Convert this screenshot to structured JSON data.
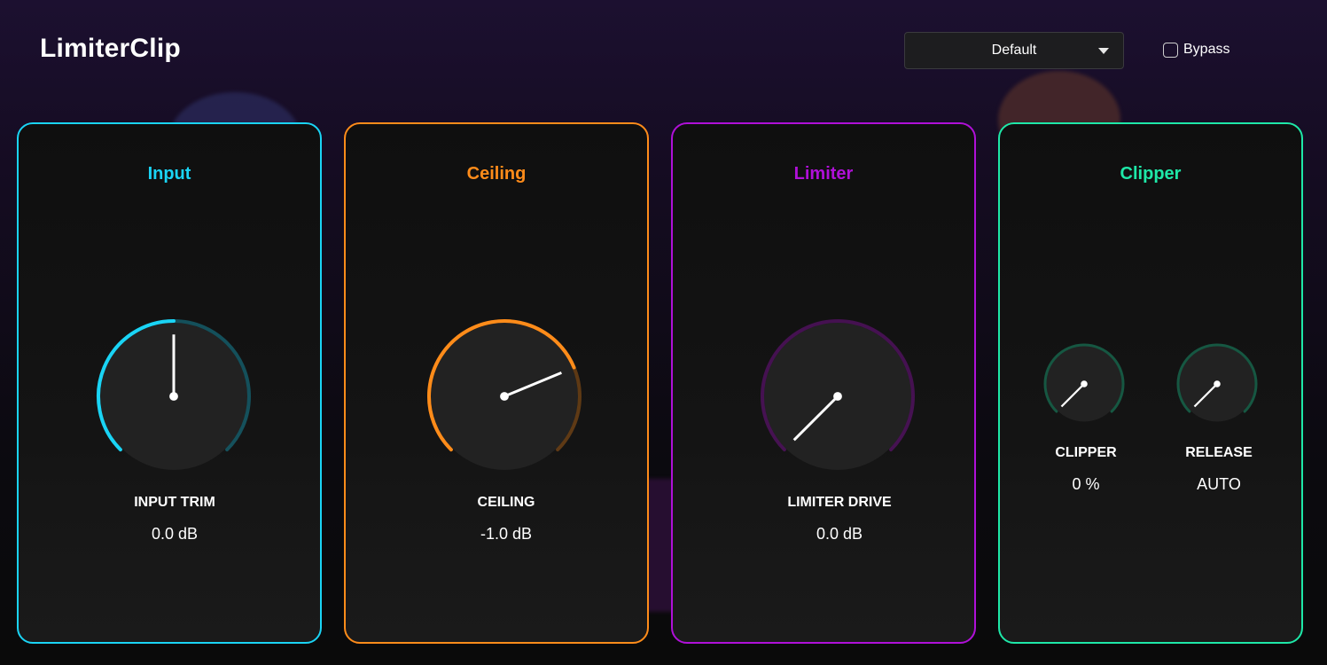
{
  "app": {
    "title": "LimiterClip"
  },
  "preset": {
    "selected": "Default"
  },
  "bypass": {
    "label": "Bypass",
    "checked": false
  },
  "panels": [
    {
      "title": "Input",
      "color": "#1ad4f5",
      "knobs": [
        {
          "label": "INPUT TRIM",
          "value": "0.0 dB",
          "position": 0.5
        }
      ]
    },
    {
      "title": "Ceiling",
      "color": "#ff8c1a",
      "knobs": [
        {
          "label": "CEILING",
          "value": "-1.0 dB",
          "position": 0.75
        }
      ]
    },
    {
      "title": "Limiter",
      "color": "#b010d8",
      "knobs": [
        {
          "label": "LIMITER DRIVE",
          "value": "0.0 dB",
          "position": 0.0
        }
      ]
    },
    {
      "title": "Clipper",
      "color": "#1ee8a8",
      "knobs": [
        {
          "label": "CLIPPER",
          "value": "0 %",
          "position": 0.0
        },
        {
          "label": "RELEASE",
          "value": "AUTO",
          "position": 0.0
        }
      ]
    }
  ]
}
